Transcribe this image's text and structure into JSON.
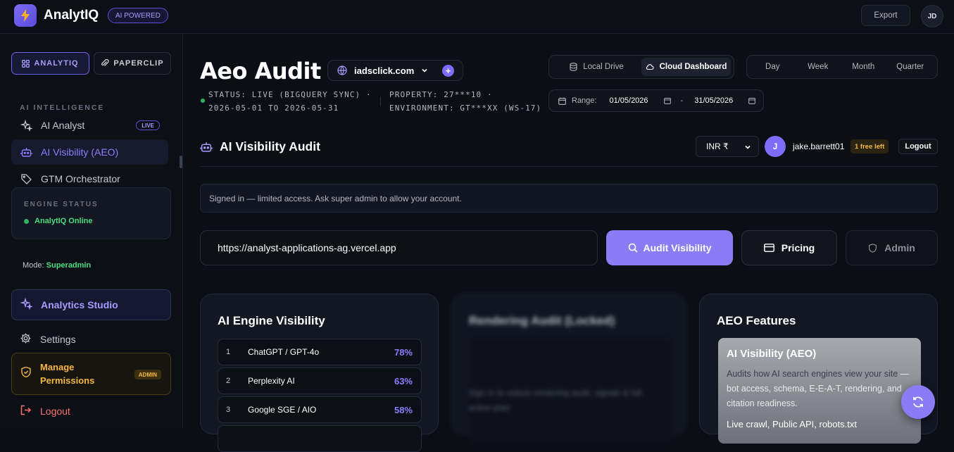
{
  "app": {
    "name": "AnalytIQ",
    "badge": "AI POWERED"
  },
  "topbar": {
    "export_label": "Export",
    "user_initials": "JD"
  },
  "sidebar": {
    "tabs": [
      {
        "label": "ANALYTIQ"
      },
      {
        "label": "PAPERCLIP"
      }
    ],
    "section_label": "AI INTELLIGENCE",
    "items": [
      {
        "label": "AI Analyst",
        "badge": "LIVE"
      },
      {
        "label": "AI Visibility (AEO)"
      },
      {
        "label": "GTM Orchestrator"
      }
    ],
    "engine_status": {
      "title": "ENGINE STATUS",
      "value": "AnalytIQ Online"
    },
    "mode": {
      "label": "Mode:",
      "value": "Superadmin"
    },
    "studio_label": "Analytics Studio",
    "settings_label": "Settings",
    "manage": {
      "label": "Manage Permissions",
      "badge": "ADMIN"
    },
    "logout_label": "Logout"
  },
  "header": {
    "title": "Aeo Audit",
    "site": "iadsclick.com",
    "status_line1": "STATUS: LIVE (BIGQUERY SYNC) ·",
    "status_line2": "2026-05-01 TO 2026-05-31",
    "property_line": "PROPERTY: 27***10 ·",
    "environment_line": "ENVIRONMENT: GT***XX (WS-17)",
    "source_toggle": [
      {
        "label": "Local Drive"
      },
      {
        "label": "Cloud Dashboard",
        "selected": true
      }
    ],
    "periods": [
      "Day",
      "Week",
      "Month",
      "Quarter"
    ],
    "range": {
      "label": "Range:",
      "start": "01/05/2026",
      "end": "31/05/2026",
      "separator": "-"
    }
  },
  "audit": {
    "heading": "AI Visibility Audit",
    "currency": "INR ₹",
    "user_initial": "J",
    "username": "jake.barrett01",
    "free_badge": "1 free left",
    "logout_label": "Logout",
    "notice": "Signed in — limited access. Ask super admin to allow your account.",
    "url_value": "https://analyst-applications-ag.vercel.app",
    "audit_button": "Audit Visibility",
    "pricing_button": "Pricing",
    "admin_button": "Admin"
  },
  "cards": {
    "engines": {
      "title": "AI Engine Visibility",
      "rows": [
        {
          "num": "1",
          "name": "ChatGPT / GPT-4o",
          "pct": "78%"
        },
        {
          "num": "2",
          "name": "Perplexity AI",
          "pct": "63%"
        },
        {
          "num": "3",
          "name": "Google SGE / AIO",
          "pct": "58%"
        }
      ]
    },
    "rendering": {
      "title": "Rendering Audit (Locked)",
      "text": "Sign in to unlock rendering audit, signals & full action plan"
    },
    "features": {
      "title": "AEO Features",
      "box_title": "AI Visibility (AEO)",
      "desc_dark": "Audits how AI search engines view your site",
      "desc_light": "— bot access, schema, E-E-A-T, rendering, and citation readiness.",
      "tags": "Live crawl, Public API, robots.txt"
    }
  },
  "colors": {
    "accent": "#8b7cf6",
    "online": "#4ade80",
    "warning": "#f5b941",
    "danger": "#f87171"
  }
}
